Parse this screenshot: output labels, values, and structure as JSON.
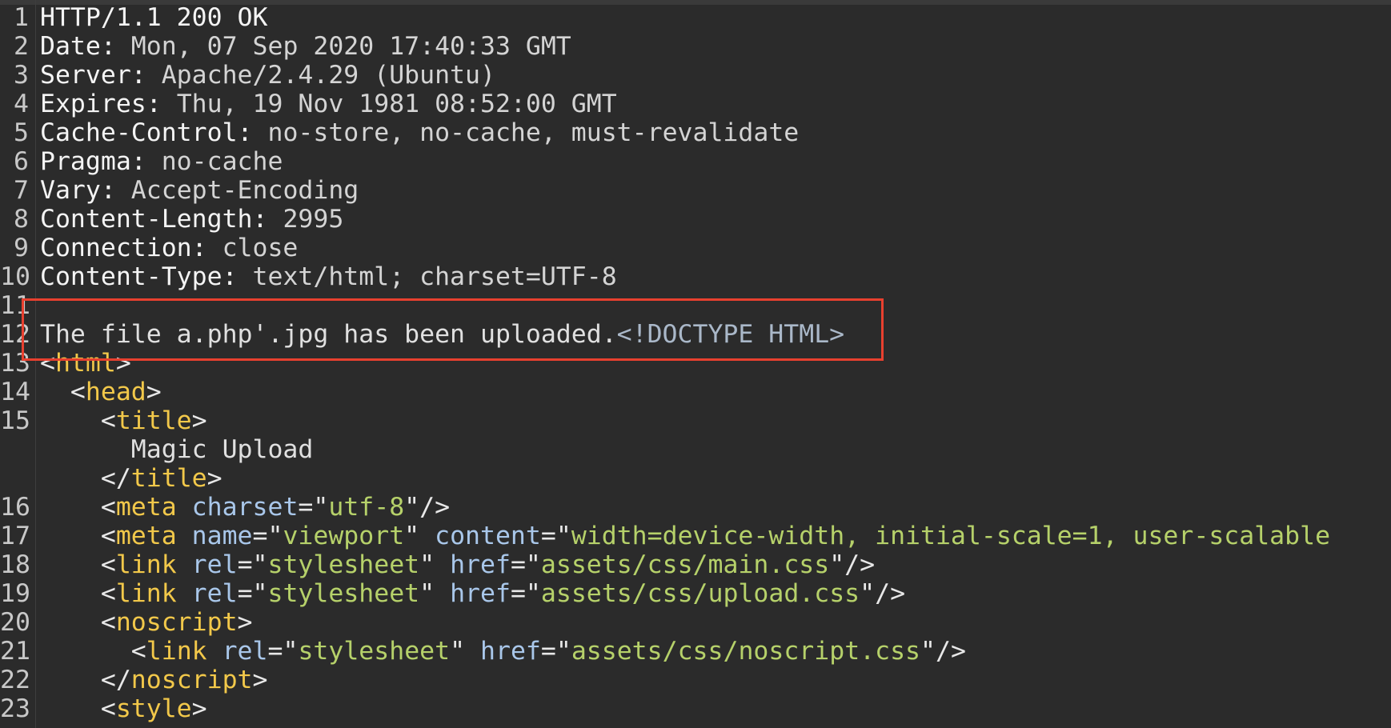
{
  "editor": {
    "lines": [
      {
        "no": "1",
        "parts": [
          {
            "t": "HTTP/1.1 200 OK",
            "c": "hk"
          }
        ]
      },
      {
        "no": "2",
        "parts": [
          {
            "t": "Date: ",
            "c": "hk"
          },
          {
            "t": "Mon, 07 Sep 2020 17:40:33 GMT",
            "c": "hv"
          }
        ]
      },
      {
        "no": "3",
        "parts": [
          {
            "t": "Server: ",
            "c": "hk"
          },
          {
            "t": "Apache/2.4.29 (Ubuntu)",
            "c": "hv"
          }
        ]
      },
      {
        "no": "4",
        "parts": [
          {
            "t": "Expires: ",
            "c": "hk"
          },
          {
            "t": "Thu, 19 Nov 1981 08:52:00 GMT",
            "c": "hv"
          }
        ]
      },
      {
        "no": "5",
        "parts": [
          {
            "t": "Cache-Control: ",
            "c": "hk"
          },
          {
            "t": "no-store, no-cache, must-revalidate",
            "c": "hv"
          }
        ]
      },
      {
        "no": "6",
        "parts": [
          {
            "t": "Pragma: ",
            "c": "hk"
          },
          {
            "t": "no-cache",
            "c": "hv"
          }
        ]
      },
      {
        "no": "7",
        "parts": [
          {
            "t": "Vary: ",
            "c": "hk"
          },
          {
            "t": "Accept-Encoding",
            "c": "hv"
          }
        ]
      },
      {
        "no": "8",
        "parts": [
          {
            "t": "Content-Length: ",
            "c": "hk"
          },
          {
            "t": "2995",
            "c": "hv"
          }
        ]
      },
      {
        "no": "9",
        "parts": [
          {
            "t": "Connection: ",
            "c": "hk"
          },
          {
            "t": "close",
            "c": "hv"
          }
        ]
      },
      {
        "no": "10",
        "parts": [
          {
            "t": "Content-Type: ",
            "c": "hk"
          },
          {
            "t": "text/html; charset=UTF-8",
            "c": "hv"
          }
        ]
      },
      {
        "no": "11",
        "parts": []
      },
      {
        "no": "12",
        "parts": [
          {
            "t": "The file a.php'.jpg has been uploaded.",
            "c": "tx"
          },
          {
            "t": "<!DOCTYPE HTML>",
            "c": "dt"
          }
        ]
      },
      {
        "no": "13",
        "parts": [
          {
            "t": "<",
            "c": "pu"
          },
          {
            "t": "html",
            "c": "tg"
          },
          {
            "t": ">",
            "c": "pu"
          }
        ]
      },
      {
        "no": "14",
        "parts": [
          {
            "t": "  <",
            "c": "pu"
          },
          {
            "t": "head",
            "c": "tg"
          },
          {
            "t": ">",
            "c": "pu"
          }
        ]
      },
      {
        "no": "15",
        "parts": [
          {
            "t": "    <",
            "c": "pu"
          },
          {
            "t": "title",
            "c": "tg"
          },
          {
            "t": ">",
            "c": "pu"
          }
        ]
      },
      {
        "no": "",
        "parts": [
          {
            "t": "      Magic Upload",
            "c": "tx"
          }
        ]
      },
      {
        "no": "",
        "parts": [
          {
            "t": "    </",
            "c": "pu"
          },
          {
            "t": "title",
            "c": "tg"
          },
          {
            "t": ">",
            "c": "pu"
          }
        ]
      },
      {
        "no": "16",
        "parts": [
          {
            "t": "    <",
            "c": "pu"
          },
          {
            "t": "meta",
            "c": "tg"
          },
          {
            "t": " ",
            "c": "pu"
          },
          {
            "t": "charset",
            "c": "at"
          },
          {
            "t": "=\"",
            "c": "pu"
          },
          {
            "t": "utf-8",
            "c": "sv"
          },
          {
            "t": "\"/>",
            "c": "pu"
          }
        ]
      },
      {
        "no": "17",
        "parts": [
          {
            "t": "    <",
            "c": "pu"
          },
          {
            "t": "meta",
            "c": "tg"
          },
          {
            "t": " ",
            "c": "pu"
          },
          {
            "t": "name",
            "c": "at"
          },
          {
            "t": "=\"",
            "c": "pu"
          },
          {
            "t": "viewport",
            "c": "sv"
          },
          {
            "t": "\" ",
            "c": "pu"
          },
          {
            "t": "content",
            "c": "at"
          },
          {
            "t": "=\"",
            "c": "pu"
          },
          {
            "t": "width=device-width, initial-scale=1, user-scalable",
            "c": "sv"
          }
        ]
      },
      {
        "no": "18",
        "parts": [
          {
            "t": "    <",
            "c": "pu"
          },
          {
            "t": "link",
            "c": "tg"
          },
          {
            "t": " ",
            "c": "pu"
          },
          {
            "t": "rel",
            "c": "at"
          },
          {
            "t": "=\"",
            "c": "pu"
          },
          {
            "t": "stylesheet",
            "c": "sv"
          },
          {
            "t": "\" ",
            "c": "pu"
          },
          {
            "t": "href",
            "c": "at"
          },
          {
            "t": "=\"",
            "c": "pu"
          },
          {
            "t": "assets/css/main.css",
            "c": "sv"
          },
          {
            "t": "\"/>",
            "c": "pu"
          }
        ]
      },
      {
        "no": "19",
        "parts": [
          {
            "t": "    <",
            "c": "pu"
          },
          {
            "t": "link",
            "c": "tg"
          },
          {
            "t": " ",
            "c": "pu"
          },
          {
            "t": "rel",
            "c": "at"
          },
          {
            "t": "=\"",
            "c": "pu"
          },
          {
            "t": "stylesheet",
            "c": "sv"
          },
          {
            "t": "\" ",
            "c": "pu"
          },
          {
            "t": "href",
            "c": "at"
          },
          {
            "t": "=\"",
            "c": "pu"
          },
          {
            "t": "assets/css/upload.css",
            "c": "sv"
          },
          {
            "t": "\"/>",
            "c": "pu"
          }
        ]
      },
      {
        "no": "20",
        "parts": [
          {
            "t": "    <",
            "c": "pu"
          },
          {
            "t": "noscript",
            "c": "tg"
          },
          {
            "t": ">",
            "c": "pu"
          }
        ]
      },
      {
        "no": "21",
        "parts": [
          {
            "t": "      <",
            "c": "pu"
          },
          {
            "t": "link",
            "c": "tg"
          },
          {
            "t": " ",
            "c": "pu"
          },
          {
            "t": "rel",
            "c": "at"
          },
          {
            "t": "=\"",
            "c": "pu"
          },
          {
            "t": "stylesheet",
            "c": "sv"
          },
          {
            "t": "\" ",
            "c": "pu"
          },
          {
            "t": "href",
            "c": "at"
          },
          {
            "t": "=\"",
            "c": "pu"
          },
          {
            "t": "assets/css/noscript.css",
            "c": "sv"
          },
          {
            "t": "\"/>",
            "c": "pu"
          }
        ]
      },
      {
        "no": "22",
        "parts": [
          {
            "t": "    </",
            "c": "pu"
          },
          {
            "t": "noscript",
            "c": "tg"
          },
          {
            "t": ">",
            "c": "pu"
          }
        ]
      },
      {
        "no": "23",
        "parts": [
          {
            "t": "    <",
            "c": "pu"
          },
          {
            "t": "style",
            "c": "tg"
          },
          {
            "t": ">",
            "c": "pu"
          }
        ]
      }
    ]
  },
  "colors": {
    "background": "#2b2b2b",
    "highlight_box": "#e8402f",
    "tag": "#f2c84a",
    "attribute": "#a9c7ea",
    "string": "#b6d16a"
  }
}
